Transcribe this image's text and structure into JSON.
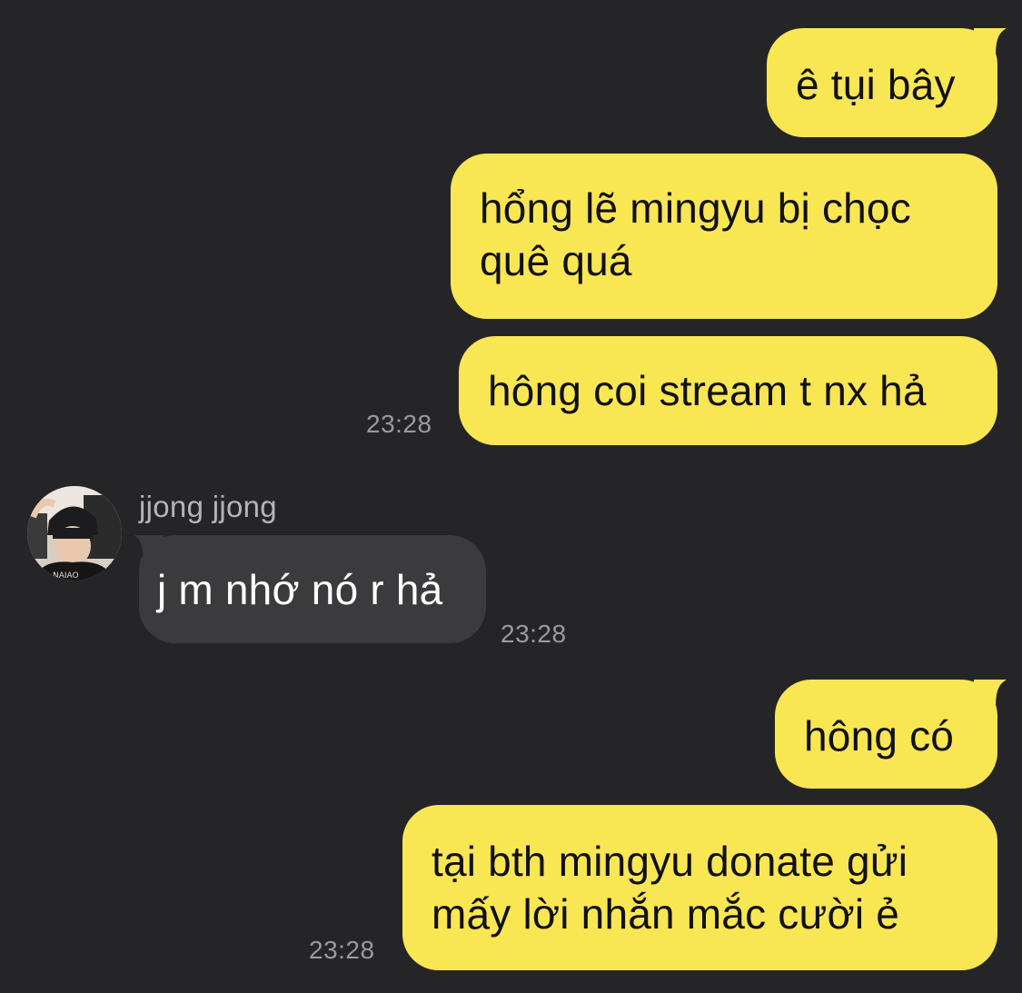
{
  "conversation": {
    "messages": [
      {
        "direction": "outgoing",
        "lines": [
          "ê tụi bây"
        ]
      },
      {
        "direction": "outgoing",
        "lines": [
          "hổng lẽ mingyu bị chọc",
          "quê quá"
        ]
      },
      {
        "direction": "outgoing",
        "lines": [
          "hông coi stream t nx hả"
        ],
        "time": "23:28"
      },
      {
        "direction": "incoming",
        "sender": "jjong jjong",
        "avatar_icon": "user-avatar-photo",
        "lines": [
          "j m nhớ nó r hả"
        ],
        "time": "23:28"
      },
      {
        "direction": "outgoing",
        "lines": [
          "hông có"
        ]
      },
      {
        "direction": "outgoing",
        "lines": [
          "tại bth mingyu donate gửi",
          "mấy lời nhắn mắc cười ẻ"
        ],
        "time": "23:28"
      }
    ]
  },
  "colors": {
    "background": "#252528",
    "outgoing_bubble": "#f9e653",
    "incoming_bubble": "#3b3b3e",
    "timestamp": "#9a9a9d"
  }
}
